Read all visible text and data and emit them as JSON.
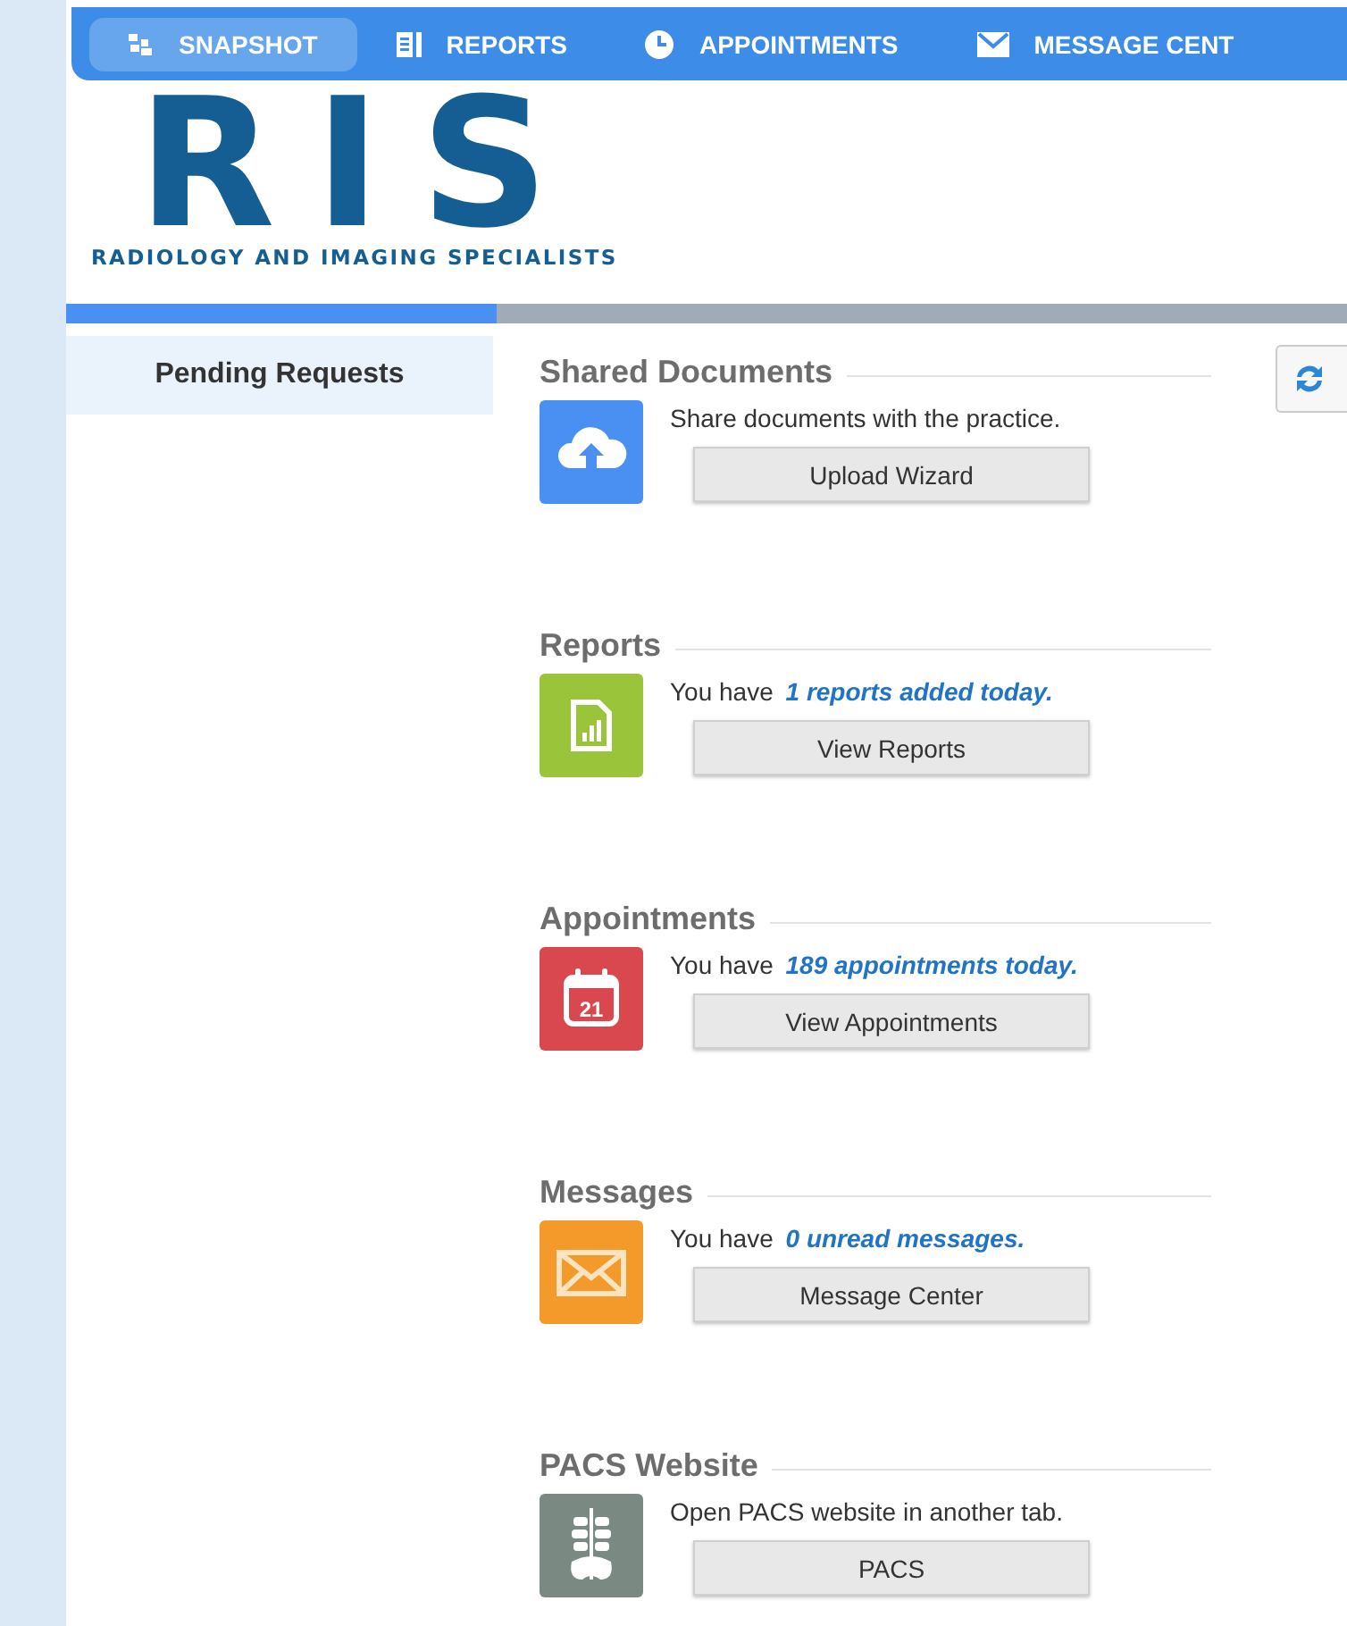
{
  "nav": [
    {
      "label": "SNAPSHOT",
      "selected": true
    },
    {
      "label": "REPORTS",
      "selected": false
    },
    {
      "label": "APPOINTMENTS",
      "selected": false
    },
    {
      "label": "MESSAGE CENT",
      "selected": false
    }
  ],
  "logo": {
    "letters": "RIS",
    "tagline": "RADIOLOGY AND IMAGING SPECIALISTS"
  },
  "sidebar": {
    "items": [
      {
        "label": "Pending Requests",
        "selected": true
      }
    ]
  },
  "sections": [
    {
      "title": "Shared Documents",
      "kind": "upload",
      "text": "Share documents with the practice.",
      "button": "Upload Wizard"
    },
    {
      "title": "Reports",
      "kind": "report",
      "text": "You have **1 reports added today.**",
      "button": "View Reports"
    },
    {
      "title": "Appointments",
      "kind": "calendar",
      "text": "You have **189 appointments today.**",
      "button": "View Appointments",
      "icon_text": "21"
    },
    {
      "title": "Messages",
      "kind": "mail",
      "text": "You have **0 unread messages.**",
      "button": "Message Center"
    },
    {
      "title": "PACS Website",
      "kind": "pacs",
      "text": "Open PACS website in another tab.",
      "button": "PACS"
    }
  ]
}
